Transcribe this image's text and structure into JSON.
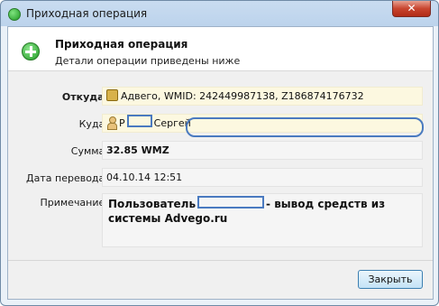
{
  "window": {
    "title": "Приходная операция",
    "close_label": "✕"
  },
  "header": {
    "title": "Приходная операция",
    "subtitle": "Детали операции приведены ниже"
  },
  "fields": {
    "from": {
      "label": "Откуда:",
      "value": "Адвего, WMID: 242449987138, Z186874176732"
    },
    "to": {
      "label": "Куда:",
      "value_prefix": "Р",
      "value_name": "Сергей"
    },
    "amount": {
      "label": "Сумма:",
      "value": "32.85 WMZ"
    },
    "date": {
      "label": "Дата перевода:",
      "value": "04.10.14 12:51"
    },
    "note": {
      "label": "Примечание:",
      "value_part1": "Пользователь",
      "value_part2": "- вывод средств из системы Advego.ru"
    }
  },
  "footer": {
    "close_button": "Закрыть"
  }
}
